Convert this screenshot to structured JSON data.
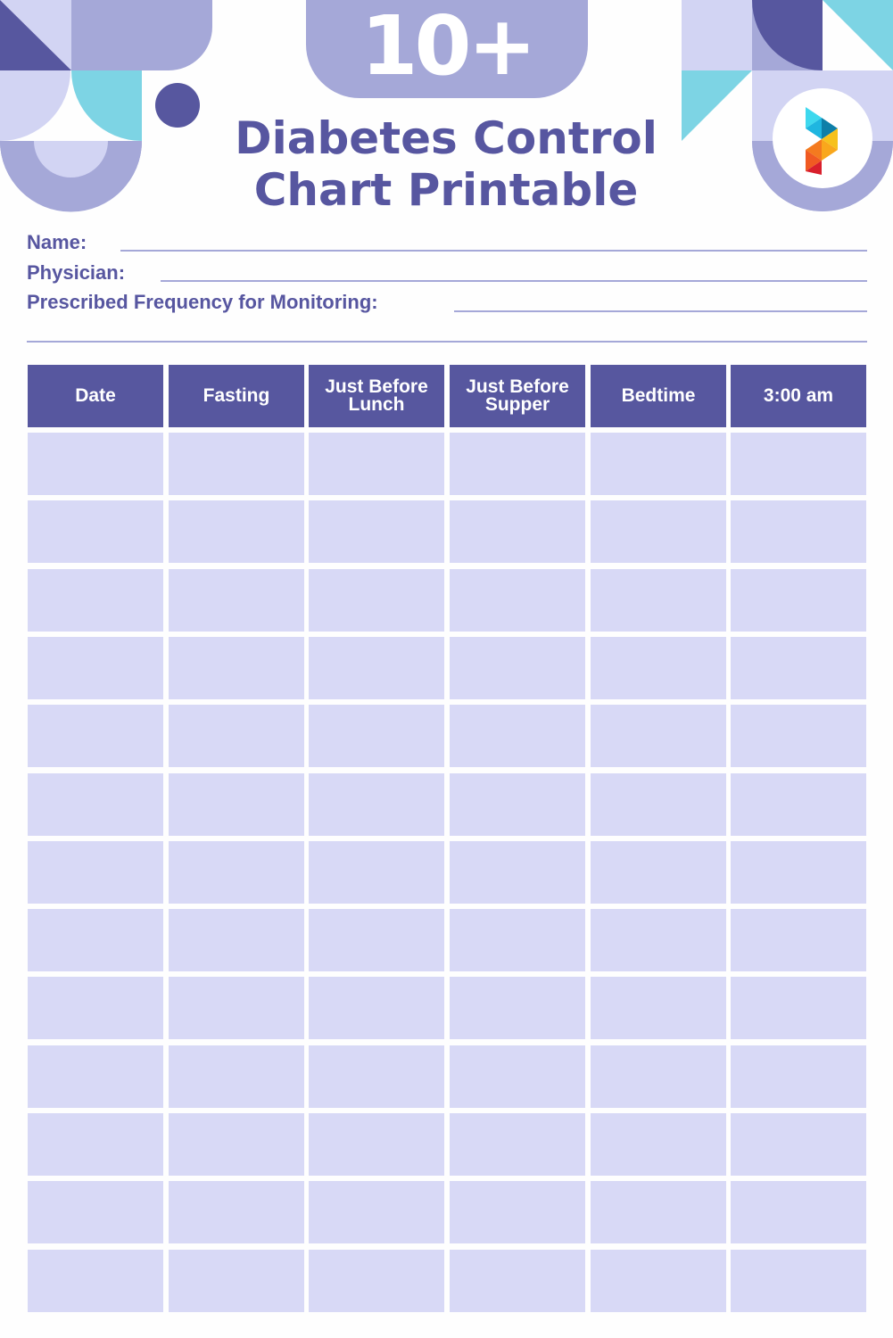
{
  "header": {
    "badge_text": "10+",
    "title_line1": "Diabetes Control",
    "title_line2": "Chart Printable",
    "logo_icon": "pinterest-style-multicolor-p-logo"
  },
  "form_fields": {
    "name_label": "Name:",
    "physician_label": "Physician:",
    "frequency_label": "Prescribed Frequency for Monitoring:"
  },
  "table": {
    "columns": [
      "Date",
      "Fasting",
      "Just Before Lunch",
      "Just Before Supper",
      "Bedtime",
      "3:00 am"
    ],
    "row_count": 13
  },
  "colors": {
    "primary": "#57579f",
    "light": "#d8d9f6",
    "mid": "#a5a8d8",
    "cyan": "#7dd4e4"
  }
}
